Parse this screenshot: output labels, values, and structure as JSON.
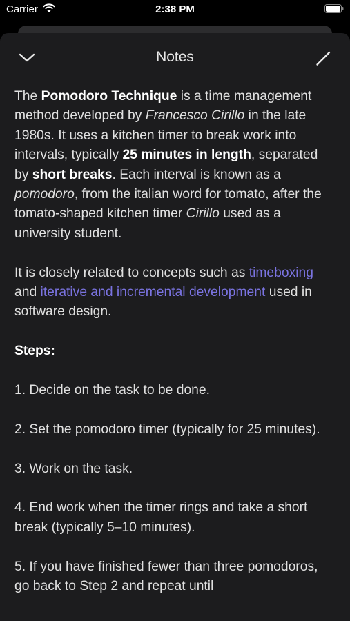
{
  "status_bar": {
    "carrier": "Carrier",
    "time": "2:38 PM"
  },
  "nav": {
    "title": "Notes",
    "collapse_icon": "chevron-down-icon",
    "edit_icon": "pencil-icon"
  },
  "note": {
    "p1": {
      "t1": "The ",
      "b1": "Pomodoro Technique",
      "t2": " is a time management method developed by ",
      "i1": "Francesco Cirillo",
      "t3": " in the late 1980s. It uses a kitchen timer to break work into intervals, typically ",
      "b2": "25 minutes in length",
      "t4": ", separated by ",
      "b3": "short breaks",
      "t5": ". Each interval is known as a ",
      "i2": "pomodoro",
      "t6": ", from the italian word for tomato, after the tomato-shaped kitchen timer ",
      "i3": "Cirillo",
      "t7": " used as a university student."
    },
    "p2": {
      "t1": "It is closely related to concepts such as ",
      "link1": "timeboxing",
      "t2": " and ",
      "link2": "iterative and incremental development",
      "t3": " used in software design."
    },
    "steps_heading": "Steps:",
    "steps": [
      "1. Decide on the task to be done.",
      "2. Set the pomodoro timer (typically for 25 minutes).",
      "3. Work on the task.",
      "4. End work when the timer rings and take a short break (typically 5–10 minutes).",
      "5. If you have finished fewer than three pomodoros, go back to Step 2 and repeat until"
    ]
  },
  "colors": {
    "link": "#7a73e0",
    "sheet_bg": "#1c1c1e"
  }
}
